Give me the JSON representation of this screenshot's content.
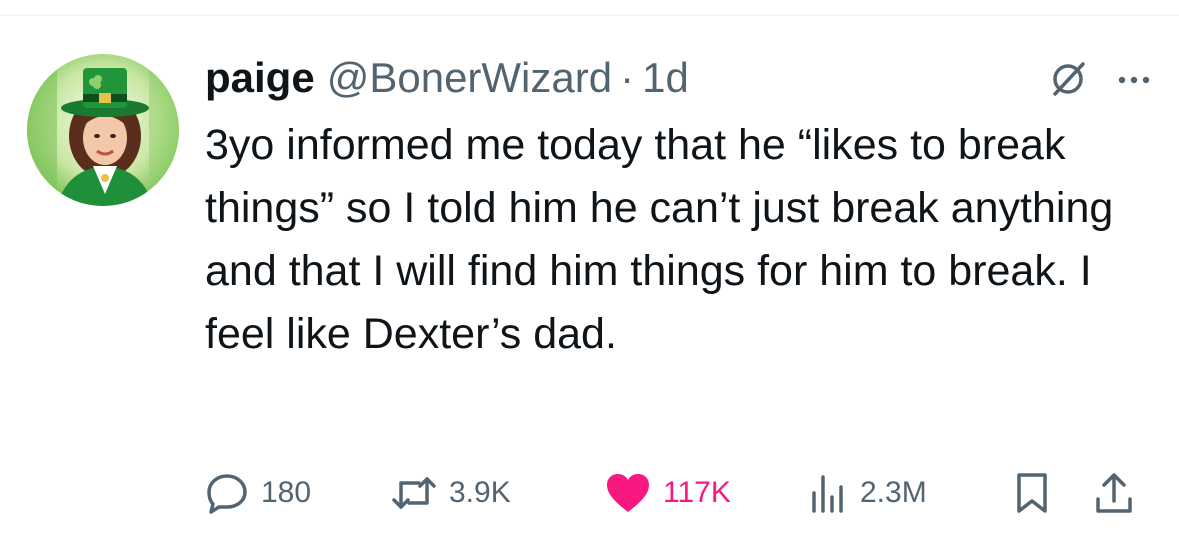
{
  "tweet": {
    "display_name": "paige",
    "handle": "@BonerWizard",
    "separator": "·",
    "time": "1d",
    "text": "3yo informed me today that he “likes to break things” so I told him he can’t just break anything and that I will find him things for him to break. I feel like Dexter’s dad."
  },
  "actions": {
    "replies": "180",
    "retweets": "3.9K",
    "likes": "117K",
    "views": "2.3M"
  },
  "icons": {
    "reply": "speech-bubble-icon",
    "retweet": "retweet-arrows-icon",
    "like": "heart-filled-icon",
    "views": "bar-chart-icon",
    "bookmark": "bookmark-icon",
    "share": "share-upload-icon",
    "grok": "grok-slash-icon",
    "more": "more-dots-icon"
  },
  "colors": {
    "text_primary": "#0f1419",
    "text_secondary": "#536471",
    "like_active": "#f91880",
    "divider": "#eff3f4",
    "avatar_green": "#1f8f3a"
  }
}
